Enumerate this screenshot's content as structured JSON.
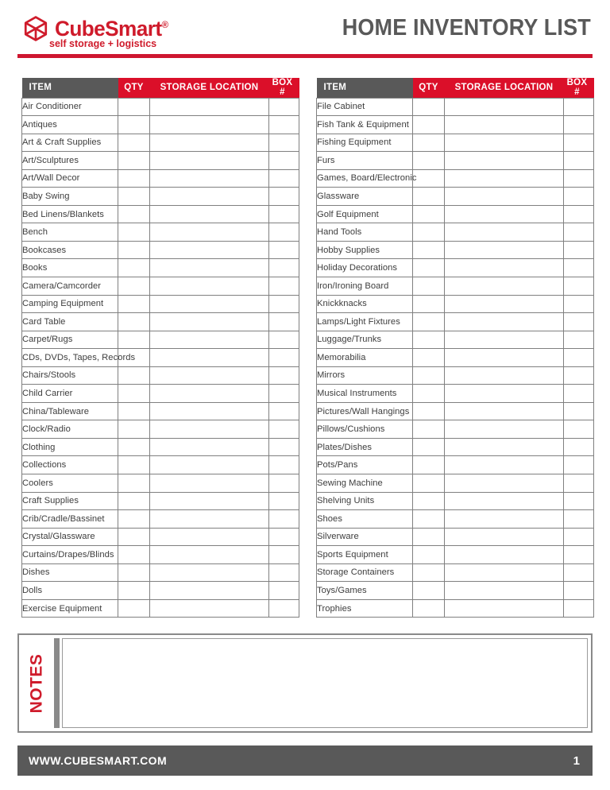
{
  "header": {
    "brand_name": "CubeSmart",
    "brand_trademark": "®",
    "tagline": "self storage + logistics",
    "logo_icon": "cube-icon",
    "document_title": "HOME INVENTORY LIST"
  },
  "colors": {
    "brand_red": "#CF1B2B",
    "header_red": "#DB0F29",
    "rule_red": "#CE1630",
    "gray_dark": "#595959",
    "border_gray": "#808080"
  },
  "table_headers": {
    "item": "ITEM",
    "qty": "QTY",
    "storage_location": "STORAGE LOCATION",
    "box": "BOX #"
  },
  "left_table": {
    "items": [
      "Air Conditioner",
      "Antiques",
      "Art & Craft Supplies",
      "Art/Sculptures",
      "Art/Wall Decor",
      "Baby Swing",
      "Bed Linens/Blankets",
      "Bench",
      "Bookcases",
      "Books",
      "Camera/Camcorder",
      "Camping Equipment",
      "Card Table",
      "Carpet/Rugs",
      "CDs, DVDs, Tapes, Records",
      "Chairs/Stools",
      "Child Carrier",
      "China/Tableware",
      "Clock/Radio",
      "Clothing",
      "Collections",
      "Coolers",
      "Craft Supplies",
      "Crib/Cradle/Bassinet",
      "Crystal/Glassware",
      "Curtains/Drapes/Blinds",
      "Dishes",
      "Dolls",
      "Exercise Equipment"
    ]
  },
  "right_table": {
    "items": [
      "File Cabinet",
      "Fish Tank & Equipment",
      "Fishing Equipment",
      "Furs",
      "Games, Board/Electronic",
      "Glassware",
      "Golf Equipment",
      "Hand Tools",
      "Hobby Supplies",
      "Holiday Decorations",
      "Iron/Ironing Board",
      "Knickknacks",
      "Lamps/Light Fixtures",
      "Luggage/Trunks",
      "Memorabilia",
      "Mirrors",
      "Musical Instruments",
      "Pictures/Wall Hangings",
      "Pillows/Cushions",
      "Plates/Dishes",
      "Pots/Pans",
      "Sewing Machine",
      "Shelving Units",
      "Shoes",
      "Silverware",
      "Sports Equipment",
      "Storage Containers",
      "Toys/Games",
      "Trophies"
    ]
  },
  "notes": {
    "label": "NOTES",
    "value": ""
  },
  "footer": {
    "url": "WWW.CUBESMART.COM",
    "page_number": "1"
  }
}
